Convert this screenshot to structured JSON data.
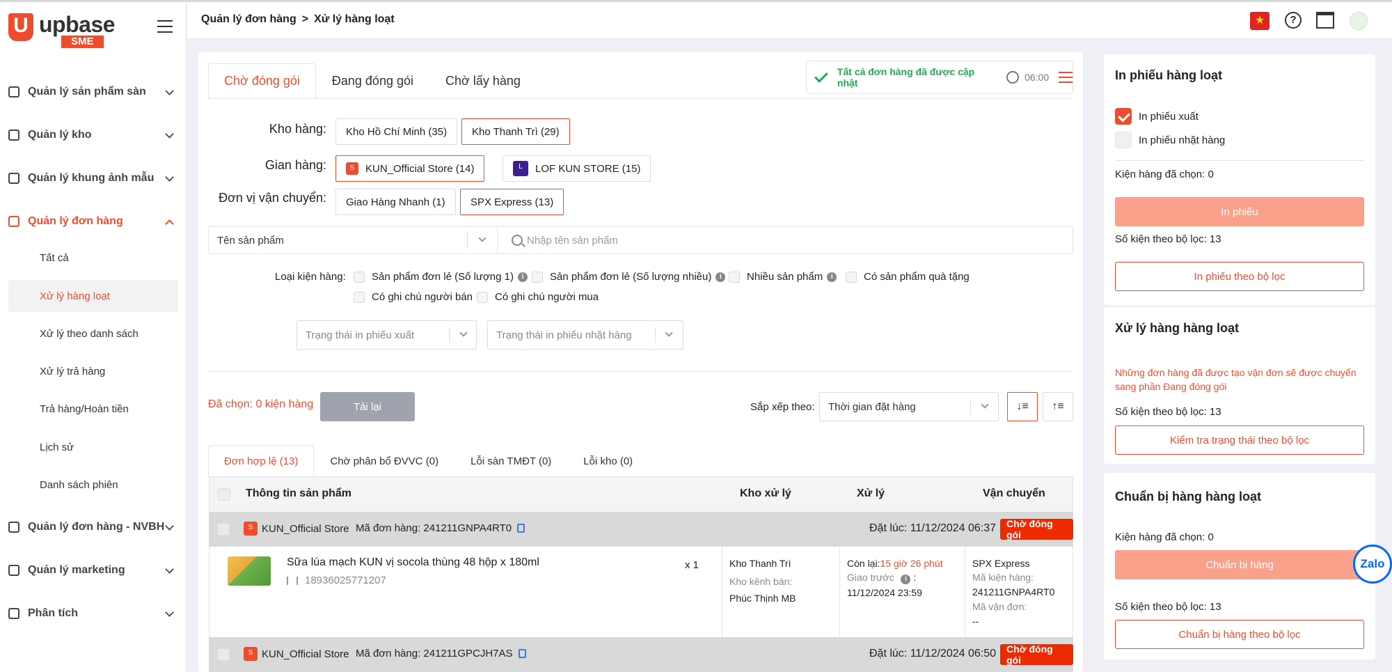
{
  "logo": {
    "brand": "upbase",
    "sub": "SME"
  },
  "sidebar": {
    "items": [
      {
        "label": "Quản lý sản phẩm sàn"
      },
      {
        "label": "Quản lý kho"
      },
      {
        "label": "Quản lý khung ảnh mẫu"
      },
      {
        "label": "Quản lý đơn hàng"
      },
      {
        "label": "Quản lý đơn hàng - NVBH"
      },
      {
        "label": "Quản lý marketing"
      },
      {
        "label": "Phân tích"
      }
    ],
    "sub_items": [
      {
        "label": "Tất cả"
      },
      {
        "label": "Xử lý hàng loạt"
      },
      {
        "label": "Xử lý theo danh sách"
      },
      {
        "label": "Xử lý trả hàng"
      },
      {
        "label": "Trả hàng/Hoàn tiền"
      },
      {
        "label": "Lịch sử"
      },
      {
        "label": "Danh sách phiên"
      }
    ]
  },
  "breadcrumb": {
    "parent": "Quản lý đơn hàng",
    "separator": ">",
    "current": "Xử lý hàng loạt"
  },
  "status_tabs": [
    {
      "label": "Chờ đóng gói"
    },
    {
      "label": "Đang đóng gói"
    },
    {
      "label": "Chờ lấy hàng"
    }
  ],
  "update": {
    "text": "Tất cả đơn hàng đã được cập nhật",
    "time": "06:00"
  },
  "filters": {
    "warehouse_label": "Kho hàng:",
    "warehouses": [
      "Kho Hồ Chí Minh (35)",
      "Kho Thanh Trì (29)"
    ],
    "shop_label": "Gian hàng:",
    "shops": [
      "KUN_Official Store (14)",
      "LOF KUN STORE (15)"
    ],
    "carrier_label": "Đơn vị vận chuyển:",
    "carriers": [
      "Giao Hàng Nhanh (1)",
      "SPX Express (13)"
    ]
  },
  "search": {
    "select_value": "Tên sản phẩm",
    "placeholder": "Nhập tên sản phẩm"
  },
  "package_type": {
    "label": "Loại kiện hàng:",
    "options": [
      "Sản phẩm đơn lẻ (Số lượng 1)",
      "Sản phẩm đơn lẻ (Số lượng nhiều)",
      "Nhiều sản phẩm",
      "Có sản phẩm quà tặng",
      "Có ghi chú người bán",
      "Có ghi chú người mua"
    ]
  },
  "print_status": {
    "export": "Trạng thái in phiếu xuất",
    "picking": "Trạng thái in phiếu nhặt hàng"
  },
  "toolbar": {
    "selected": "Đã chọn: 0 kiện hàng",
    "reload": "Tải lại",
    "sort_label": "Sắp xếp theo:",
    "sort_value": "Thời gian đặt hàng"
  },
  "sub_tabs": [
    {
      "label": "Đơn hợp lệ (13)"
    },
    {
      "label": "Chờ phân bổ ĐVVC (0)"
    },
    {
      "label": "Lỗi sàn TMĐT (0)"
    },
    {
      "label": "Lỗi kho (0)"
    }
  ],
  "table": {
    "headers": [
      "Thông tin sản phẩm",
      "Kho xử lý",
      "Xử lý",
      "Vận chuyển"
    ],
    "orders": [
      {
        "shop": "KUN_Official Store",
        "code": "Mã đơn hàng: 241211GNPA4RT0",
        "time": "Đặt lúc: 11/12/2024 06:37",
        "status": "Chờ đóng gói",
        "product_name": "Sữa lúa mạch KUN vị socola thùng 48 hộp x 180ml",
        "sku": "18936025771207",
        "qty": "x 1",
        "warehouse": "Kho Thanh Trì",
        "channel_label": "Kho kênh bán:",
        "channel_value": "Phúc Thịnh MB",
        "remaining_label": "Còn lại:",
        "remaining_value": "15 giờ 26 phút",
        "deliver_label": "Giao trước",
        "deliver_colon": ":",
        "deliver_value": "11/12/2024 23:59",
        "carrier": "SPX Express",
        "package_label": "Mã kiện hàng:",
        "package_value": "241211GNPA4RT0",
        "tracking_label": "Mã vận đơn:",
        "tracking_value": "--"
      },
      {
        "shop": "KUN_Official Store",
        "code": "Mã đơn hàng: 241211GPCJH7AS",
        "time": "Đặt lúc: 11/12/2024 06:50",
        "status": "Chờ đóng gói"
      }
    ]
  },
  "print_panel": {
    "title": "In phiếu hàng loạt",
    "export_option": "In phiếu xuất",
    "picking_option": "In phiếu nhặt hàng",
    "selected": "Kiện hàng đã chọn: 0",
    "print_button": "In phiếu",
    "filter_count": "Số kiện theo bộ lọc: 13",
    "print_filter_button": "In phiếu theo bộ lọc"
  },
  "process_panel": {
    "title": "Xử lý hàng hàng loạt",
    "note": "Những đơn hàng đã được tạo vận đơn sẽ được chuyển sang phần Đang đóng gói",
    "filter_count": "Số kiện theo bộ lọc: 13",
    "check_button": "Kiểm tra trạng thái theo bộ lọc"
  },
  "prepare_panel": {
    "title": "Chuẩn bị hàng hàng loạt",
    "selected": "Kiện hàng đã chọn: 0",
    "prepare_button": "Chuẩn bị hàng",
    "filter_count": "Số kiện theo bộ lọc: 13",
    "prepare_filter_button": "Chuẩn bị hàng theo bộ lọc"
  },
  "zalo": "Zalo",
  "colors": {
    "accent": "#ee4d2d",
    "success": "#1aae52",
    "badge": "#ee2a00"
  }
}
